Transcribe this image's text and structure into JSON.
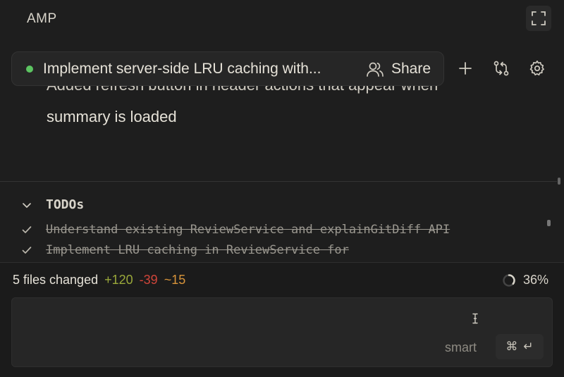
{
  "app": {
    "title": "AMP"
  },
  "thread": {
    "title": "Implement server-side LRU caching with...",
    "status_color": "#5cc461",
    "share_label": "Share"
  },
  "message": {
    "line_cut": "Added refresh button in header actions that appear when",
    "line_main": "summary is loaded"
  },
  "todos": {
    "label": "TODOs",
    "items": [
      {
        "text": "Understand existing ReviewService and explainGitDiff API",
        "done": true
      },
      {
        "text": "Implement LRU caching in ReviewService for",
        "done": true
      }
    ]
  },
  "footer": {
    "files_changed": "5 files changed",
    "added": "+120",
    "removed": "-39",
    "modified": "~15",
    "progress": "36%",
    "progress_fraction": 0.36
  },
  "input": {
    "placeholder": "",
    "mode": "smart",
    "submit_hint_icon": "⌘",
    "submit_hint_enter": "↵"
  },
  "colors": {
    "added": "#9aa83a",
    "removed": "#d0453a",
    "modified": "#d8943a"
  }
}
